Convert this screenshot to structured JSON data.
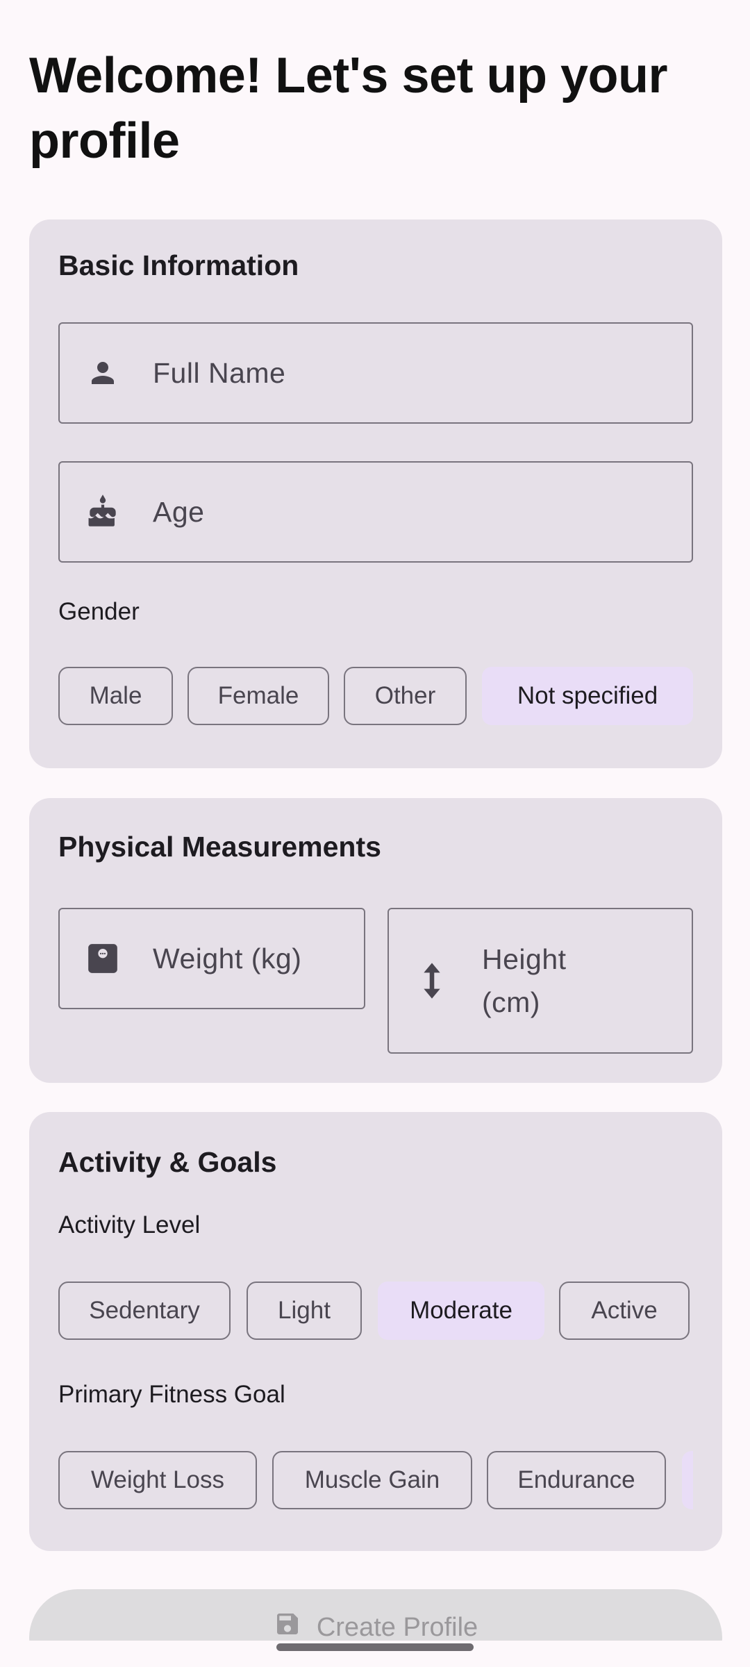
{
  "header": {
    "title": "Welcome! Let's set up your profile"
  },
  "basic_info": {
    "title": "Basic Information",
    "name_field": {
      "placeholder": "Full Name",
      "icon": "person-icon"
    },
    "age_field": {
      "placeholder": "Age",
      "icon": "cake-icon"
    },
    "gender_label": "Gender",
    "gender_options": [
      "Male",
      "Female",
      "Other",
      "Not specified"
    ],
    "gender_selected": "Not specified"
  },
  "measurements": {
    "title": "Physical Measurements",
    "weight_field": {
      "placeholder": "Weight (kg)",
      "icon": "scale-icon"
    },
    "height_field": {
      "placeholder_line1": "Height",
      "placeholder_line2": "(cm)",
      "icon": "vertical-arrows-icon"
    }
  },
  "activity": {
    "title": "Activity & Goals",
    "level_label": "Activity Level",
    "level_options": [
      "Sedentary",
      "Light",
      "Moderate",
      "Active"
    ],
    "level_selected": "Moderate",
    "goal_label": "Primary Fitness Goal",
    "goal_options": [
      "Weight Loss",
      "Muscle Gain",
      "Endurance"
    ]
  },
  "footer": {
    "create_label": "Create Profile",
    "icon": "save-icon"
  },
  "colors": {
    "background": "#fdf8fb",
    "card": "#e6e0e8",
    "selected_chip": "#e9ddf7",
    "outline": "#79747e",
    "disabled_button": "#dddcde"
  }
}
